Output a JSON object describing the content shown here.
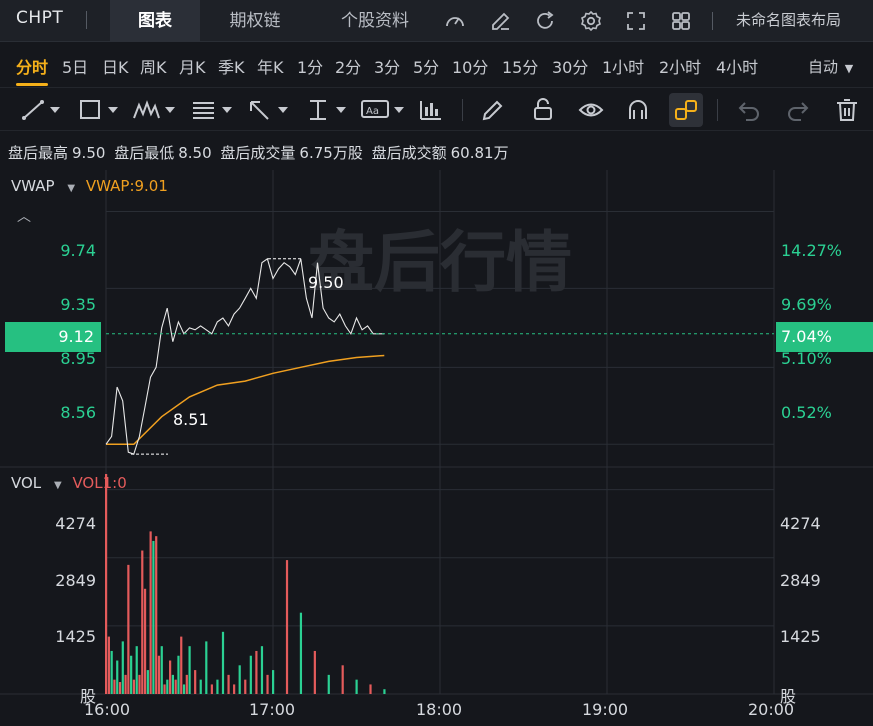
{
  "header": {
    "symbol": "CHPT",
    "tabs": [
      {
        "label": "图表",
        "active": true
      },
      {
        "label": "期权链",
        "active": false
      },
      {
        "label": "个股资料",
        "active": false
      }
    ],
    "layout_name": "未命名图表布局",
    "icons": [
      "gauge-icon",
      "edit-icon",
      "refresh-icon",
      "settings-icon",
      "fullscreen-icon",
      "grid-layout-icon"
    ]
  },
  "periods": {
    "items": [
      "分时",
      "5日",
      "日K",
      "周K",
      "月K",
      "季K",
      "年K",
      "1分",
      "2分",
      "3分",
      "5分",
      "10分",
      "15分",
      "30分",
      "1小时",
      "2小时",
      "4小时"
    ],
    "active": "分时",
    "auto_label": "自动"
  },
  "toolbar": {
    "tools": [
      "trendline-icon",
      "rectangle-icon",
      "pattern-icon",
      "fib-icon",
      "arrow-icon",
      "measure-icon",
      "text-icon",
      "indicator-icon",
      "pencil-icon",
      "lock-icon",
      "eye-icon",
      "magnet-icon",
      "link-icon",
      "undo-icon",
      "redo-icon",
      "trash-icon"
    ]
  },
  "stats": {
    "items": [
      {
        "label": "盘后最高",
        "value": "9.50"
      },
      {
        "label": "盘后最低",
        "value": "8.50"
      },
      {
        "label": "盘后成交量",
        "value": "6.75万股"
      },
      {
        "label": "盘后成交额",
        "value": "60.81万"
      }
    ]
  },
  "price_pane": {
    "indicator_name": "VWAP",
    "indicator_value_label": "VWAP:9.01",
    "watermark": "盘后行情",
    "left_ticks": [
      "9.74",
      "9.35",
      "8.95",
      "8.56"
    ],
    "right_ticks": [
      "14.27%",
      "9.69%",
      "5.10%",
      "0.52%"
    ],
    "current_price": "9.12",
    "current_pct": "7.04%",
    "high_label": "9.50",
    "low_label": "8.51"
  },
  "volume_pane": {
    "indicator_name": "VOL",
    "indicator_value_label": "VOL1:0",
    "left_ticks": [
      "4274",
      "2849",
      "1425",
      "股"
    ],
    "right_ticks": [
      "4274",
      "2849",
      "1425",
      "股"
    ]
  },
  "x_axis": {
    "ticks": [
      "16:00",
      "17:00",
      "18:00",
      "19:00",
      "20:00"
    ]
  },
  "colors": {
    "up": "#e45b5b",
    "down": "#2bd193",
    "vwap": "#f0a020",
    "price_line": "#e8e8e8",
    "accent": "#f5b01a"
  },
  "chart_data": [
    {
      "type": "line",
      "title": "",
      "series": [
        {
          "name": "",
          "x": [
            "16:00",
            "16:02",
            "16:04",
            "16:06",
            "16:08",
            "16:10",
            "16:12",
            "16:14",
            "16:16",
            "16:18",
            "16:20",
            "16:22",
            "16:24",
            "16:26",
            "16:28",
            "16:30",
            "16:32",
            "16:34",
            "16:36",
            "16:38",
            "16:40",
            "16:42",
            "16:44",
            "16:46",
            "16:48",
            "16:50",
            "16:52",
            "16:54",
            "16:56",
            "16:58",
            "17:00",
            "17:02",
            "17:04",
            "17:06",
            "17:08",
            "17:10",
            "17:12",
            "17:14",
            "17:16",
            "17:18",
            "17:20",
            "17:22",
            "17:24",
            "17:26",
            "17:28",
            "17:30",
            "17:32",
            "17:34",
            "17:36",
            "17:38",
            "17:40"
          ],
          "values": [
            8.56,
            8.6,
            8.85,
            8.78,
            8.52,
            8.51,
            8.6,
            8.75,
            8.9,
            8.95,
            9.15,
            9.25,
            9.08,
            9.18,
            9.12,
            9.15,
            9.14,
            9.16,
            9.14,
            9.12,
            9.18,
            9.2,
            9.16,
            9.22,
            9.25,
            9.3,
            9.35,
            9.3,
            9.48,
            9.5,
            9.4,
            9.45,
            9.48,
            9.46,
            9.42,
            9.5,
            9.3,
            9.2,
            9.48,
            9.25,
            9.2,
            9.18,
            9.22,
            9.16,
            9.12,
            9.2,
            9.14,
            9.16,
            9.12,
            9.12,
            9.12
          ]
        },
        {
          "name": "VWAP",
          "x": [
            "16:00",
            "16:10",
            "16:20",
            "16:30",
            "16:40",
            "16:50",
            "17:00",
            "17:10",
            "17:20",
            "17:30",
            "17:40"
          ],
          "values": [
            8.56,
            8.56,
            8.7,
            8.8,
            8.86,
            8.88,
            8.92,
            8.95,
            8.98,
            9.0,
            9.01
          ]
        }
      ],
      "ylim": [
        8.45,
        9.95
      ]
    },
    {
      "type": "bar",
      "title": "",
      "series": [
        {
          "name": "",
          "x": [
            "16:00",
            "16:01",
            "16:02",
            "16:03",
            "16:04",
            "16:05",
            "16:06",
            "16:07",
            "16:08",
            "16:09",
            "16:10",
            "16:11",
            "16:12",
            "16:13",
            "16:14",
            "16:15",
            "16:16",
            "16:17",
            "16:18",
            "16:19",
            "16:20",
            "16:21",
            "16:22",
            "16:23",
            "16:24",
            "16:25",
            "16:26",
            "16:27",
            "16:28",
            "16:29",
            "16:30",
            "16:32",
            "16:34",
            "16:36",
            "16:38",
            "16:40",
            "16:42",
            "16:44",
            "16:46",
            "16:48",
            "16:50",
            "16:52",
            "16:54",
            "16:56",
            "16:58",
            "17:00",
            "17:05",
            "17:10",
            "17:15",
            "17:20",
            "17:25",
            "17:30",
            "17:35",
            "17:40"
          ],
          "values": [
            4600,
            1200,
            900,
            300,
            700,
            250,
            1100,
            400,
            2700,
            800,
            300,
            1000,
            400,
            3000,
            2200,
            500,
            3400,
            3200,
            3300,
            800,
            1000,
            200,
            300,
            700,
            400,
            300,
            800,
            1200,
            200,
            400,
            1000,
            500,
            300,
            1100,
            200,
            300,
            1300,
            400,
            200,
            600,
            300,
            800,
            900,
            1000,
            400,
            500,
            2800,
            1700,
            900,
            400,
            600,
            300,
            200,
            100
          ],
          "direction": [
            "up",
            "up",
            "down",
            "up",
            "down",
            "up",
            "down",
            "up",
            "up",
            "down",
            "up",
            "down",
            "up",
            "up",
            "up",
            "down",
            "up",
            "down",
            "up",
            "up",
            "down",
            "up",
            "down",
            "up",
            "down",
            "up",
            "down",
            "up",
            "down",
            "up",
            "down",
            "up",
            "down",
            "down",
            "up",
            "down",
            "down",
            "up",
            "up",
            "down",
            "up",
            "down",
            "up",
            "down",
            "up",
            "down",
            "up",
            "down",
            "up",
            "down",
            "up",
            "down",
            "up",
            "down"
          ]
        }
      ],
      "ylim": [
        0,
        4600
      ]
    }
  ]
}
